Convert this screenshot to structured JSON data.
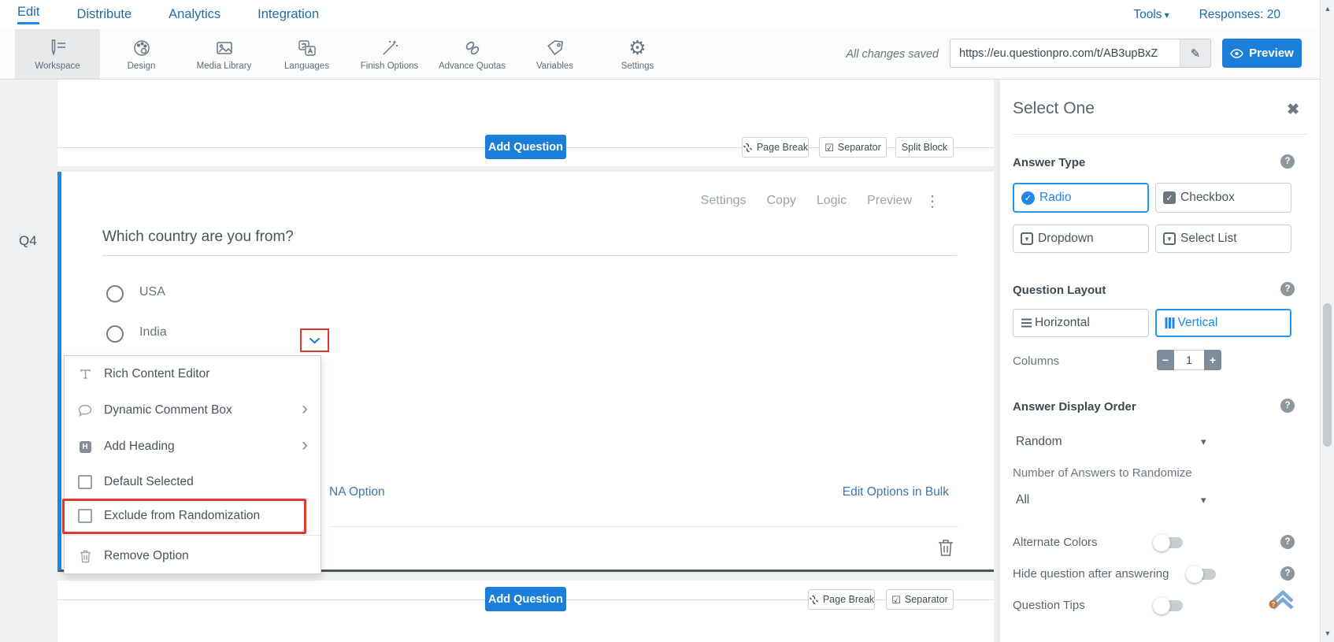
{
  "nav": {
    "tabs": [
      {
        "label": "Edit",
        "active": true
      },
      {
        "label": "Distribute",
        "active": false
      },
      {
        "label": "Analytics",
        "active": false
      },
      {
        "label": "Integration",
        "active": false
      }
    ],
    "tools_label": "Tools",
    "responses_label": "Responses: 20"
  },
  "toolbar": {
    "items": [
      {
        "label": "Workspace",
        "icon": "workspace-icon",
        "active": true
      },
      {
        "label": "Design",
        "icon": "design-palette-icon",
        "active": false
      },
      {
        "label": "Media Library",
        "icon": "media-library-icon",
        "active": false
      },
      {
        "label": "Languages",
        "icon": "languages-icon",
        "active": false
      },
      {
        "label": "Finish Options",
        "icon": "magic-wand-icon",
        "active": false
      },
      {
        "label": "Advance Quotas",
        "icon": "chain-link-icon",
        "active": false
      },
      {
        "label": "Variables",
        "icon": "tag-icon",
        "active": false
      },
      {
        "label": "Settings",
        "icon": "gear-icon",
        "active": false
      }
    ],
    "save_status": "All changes saved",
    "survey_url": "https://eu.questionpro.com/t/AB3upBxZ",
    "preview_label": "Preview"
  },
  "top_block": {
    "add_question_label": "Add Question",
    "buttons": [
      {
        "label": "Page Break"
      },
      {
        "label": "Separator"
      },
      {
        "label": "Split Block"
      }
    ]
  },
  "question": {
    "number_label": "Q4",
    "text": "Which country are you from?",
    "actions": [
      {
        "label": "Settings"
      },
      {
        "label": "Copy"
      },
      {
        "label": "Logic"
      },
      {
        "label": "Preview"
      }
    ],
    "options": [
      {
        "label": "USA"
      },
      {
        "label": "India"
      }
    ],
    "na_option_label": "NA Option",
    "bulk_edit_label": "Edit Options in Bulk"
  },
  "option_menu": {
    "items": [
      {
        "label": "Rich Content Editor",
        "icon": "text-format-icon",
        "submenu": false
      },
      {
        "label": "Dynamic Comment Box",
        "icon": "comment-bubble-icon",
        "submenu": true
      },
      {
        "label": "Add Heading",
        "icon": "heading-icon",
        "submenu": true
      },
      {
        "label": "Default Selected",
        "icon": "checkbox",
        "checked": false
      },
      {
        "label": "Exclude from Randomization",
        "icon": "checkbox",
        "checked": false,
        "highlighted": true
      },
      {
        "label": "Remove Option",
        "icon": "trash-icon"
      }
    ]
  },
  "bottom_block": {
    "add_question_label": "Add Question",
    "buttons": [
      {
        "label": "Page Break"
      },
      {
        "label": "Separator"
      }
    ]
  },
  "panel": {
    "title": "Select One",
    "answer_type": {
      "label": "Answer Type",
      "options": [
        {
          "label": "Radio",
          "selected": true
        },
        {
          "label": "Checkbox",
          "selected": false
        },
        {
          "label": "Dropdown",
          "selected": false
        },
        {
          "label": "Select List",
          "selected": false
        }
      ]
    },
    "question_layout": {
      "label": "Question Layout",
      "options": [
        {
          "label": "Horizontal",
          "selected": false
        },
        {
          "label": "Vertical",
          "selected": true
        }
      ],
      "columns_label": "Columns",
      "columns_value": "1"
    },
    "answer_display_order": {
      "label": "Answer Display Order",
      "order_value": "Random",
      "count_label": "Number of Answers to Randomize",
      "count_value": "All"
    },
    "toggles": [
      {
        "label": "Alternate Colors",
        "on": false
      },
      {
        "label": "Hide question after answering",
        "on": false
      },
      {
        "label": "Question Tips",
        "on": false
      }
    ]
  },
  "glyphs": {
    "caret_down": "▾",
    "dropdown_caret": "▼",
    "submenu_arrow": "›",
    "three_dots": "⋮",
    "close": "✖",
    "help": "?",
    "minus": "−",
    "plus": "+",
    "check": "✓",
    "pencil": "✎",
    "separator_check": "☑",
    "gear": "⚙",
    "scroll_up": "▲",
    "scroll_down": "▼",
    "heading_letter": "H"
  },
  "colors": {
    "accent_blue": "#1b7fd9",
    "selected_blue": "#2187e8",
    "nav_blue": "#1a6fa8",
    "link_blue": "#3d76ae",
    "highlight_red": "#e0382c",
    "card_border_blue": "#1e88e5"
  }
}
